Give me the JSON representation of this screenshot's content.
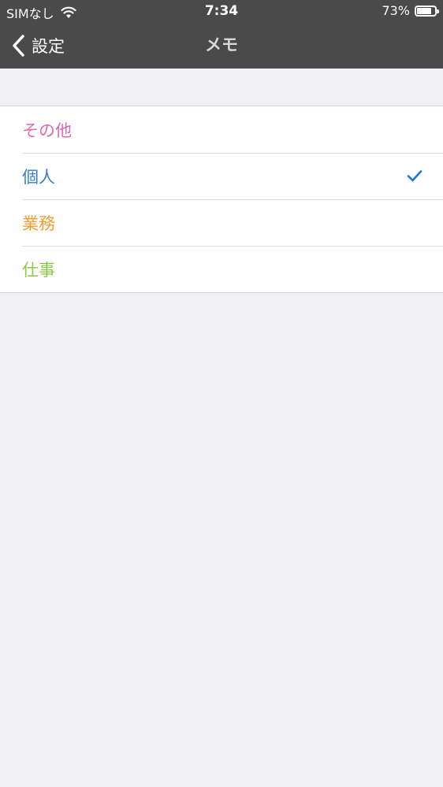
{
  "status_bar": {
    "carrier": "SIMなし",
    "time": "7:34",
    "battery_percent": "73%",
    "battery_level": 0.73,
    "wifi_icon": "wifi-icon"
  },
  "nav": {
    "back_label": "設定",
    "title": "メモ"
  },
  "list": {
    "items": [
      {
        "label": "その他",
        "color": "#d86bb8",
        "selected": false
      },
      {
        "label": "個人",
        "color": "#3a7fc8",
        "selected": true
      },
      {
        "label": "業務",
        "color": "#f0a030",
        "selected": false
      },
      {
        "label": "仕事",
        "color": "#8cc84a",
        "selected": false
      }
    ]
  },
  "colors": {
    "bar_background": "#4a4a4a",
    "page_background": "#efeff4",
    "check_color": "#1a73e8"
  }
}
